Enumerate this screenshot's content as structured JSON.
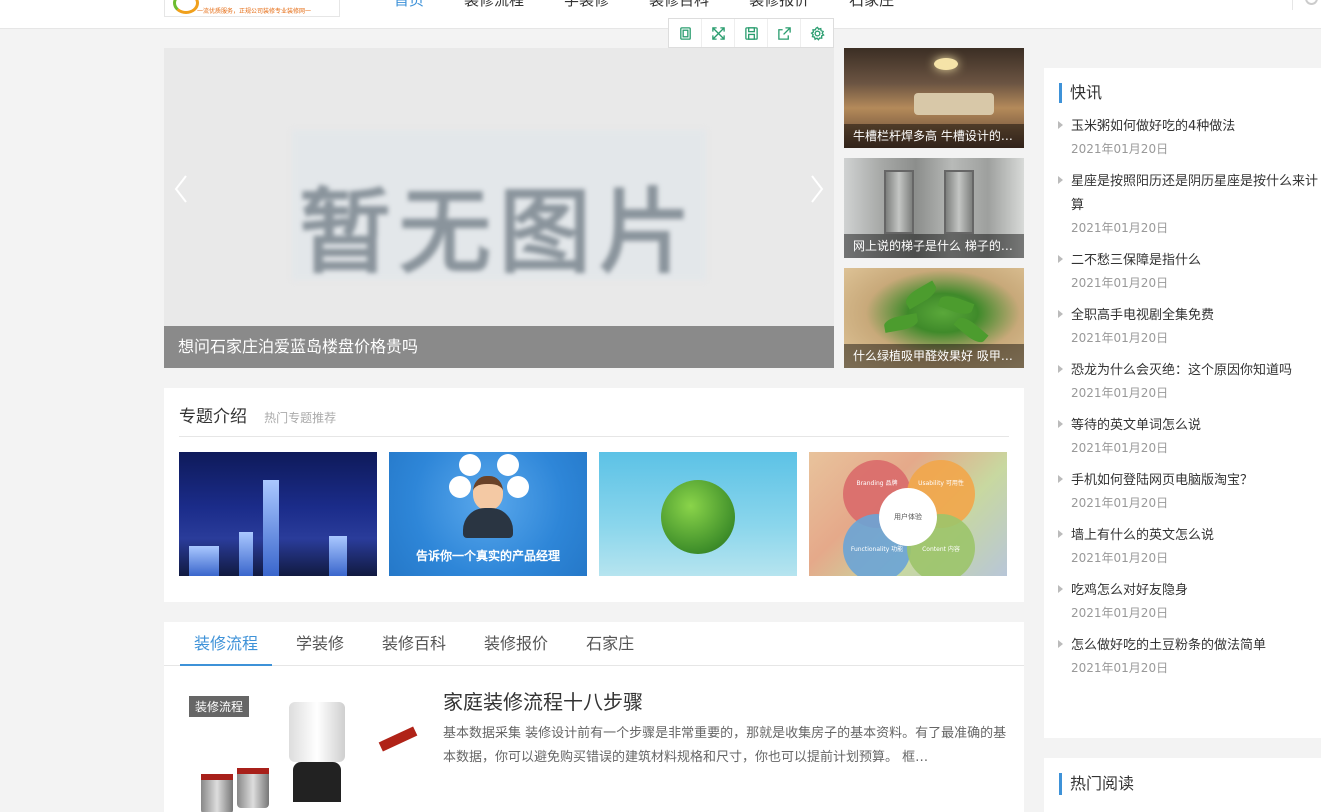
{
  "header": {
    "logo_slogan": "一流优质服务，正规公司装修专业装修网一",
    "nav": [
      "首页",
      "装修流程",
      "学装修",
      "装修百科",
      "装修报价",
      "石家庄"
    ]
  },
  "toolbar": {
    "icons": [
      "copy-icon",
      "expand-icon",
      "save-icon",
      "share-icon",
      "settings-icon"
    ]
  },
  "slider": {
    "placeholder_text": "暂无图片",
    "caption": "想问石家庄泊爱蓝岛楼盘价格贵吗"
  },
  "thumbs": [
    {
      "caption": "牛槽栏杆焊多高 牛槽设计的…"
    },
    {
      "caption": "网上说的梯子是什么 梯子的…"
    },
    {
      "caption": "什么绿植吸甲醛效果好 吸甲…"
    }
  ],
  "topic": {
    "title": "专题介绍",
    "subtitle": "热门专题推荐",
    "card2_text": "告诉你一个真实的产品经理",
    "card4": {
      "center": "用户体验",
      "branding": "Branding 品牌",
      "usability": "Usability 可用性",
      "functionality": "Functionality 功能",
      "content": "Content 内容"
    }
  },
  "tabs": {
    "items": [
      "装修流程",
      "学装修",
      "装修百科",
      "装修报价",
      "石家庄"
    ],
    "active_index": 0
  },
  "article": {
    "badge": "装修流程",
    "title": "家庭装修流程十八步骤",
    "desc": "基本数据采集 装修设计前有一个步骤是非常重要的，那就是收集房子的基本资料。有了最准确的基本数据，你可以避免购买错误的建筑材料规格和尺寸，你也可以提前计划预算。 框…"
  },
  "news": {
    "title": "快讯",
    "items": [
      {
        "title": "玉米粥如何做好吃的4种做法",
        "date": "2021年01月20日"
      },
      {
        "title": "星座是按照阳历还是阴历星座是按什么来计算",
        "date": "2021年01月20日"
      },
      {
        "title": "二不愁三保障是指什么",
        "date": "2021年01月20日"
      },
      {
        "title": "全职高手电视剧全集免费",
        "date": "2021年01月20日"
      },
      {
        "title": "恐龙为什么会灭绝：这个原因你知道吗",
        "date": "2021年01月20日"
      },
      {
        "title": "等待的英文单词怎么说",
        "date": "2021年01月20日"
      },
      {
        "title": "手机如何登陆网页电脑版淘宝？",
        "date": "2021年01月20日"
      },
      {
        "title": "墙上有什么的英文怎么说",
        "date": "2021年01月20日"
      },
      {
        "title": "吃鸡怎么对好友隐身",
        "date": "2021年01月20日"
      },
      {
        "title": "怎么做好吃的土豆粉条的做法简单",
        "date": "2021年01月20日"
      }
    ]
  },
  "hot": {
    "title": "热门阅读"
  },
  "colors": {
    "accent": "#3e92d8",
    "toolbar_icon": "#2a9d6f"
  }
}
